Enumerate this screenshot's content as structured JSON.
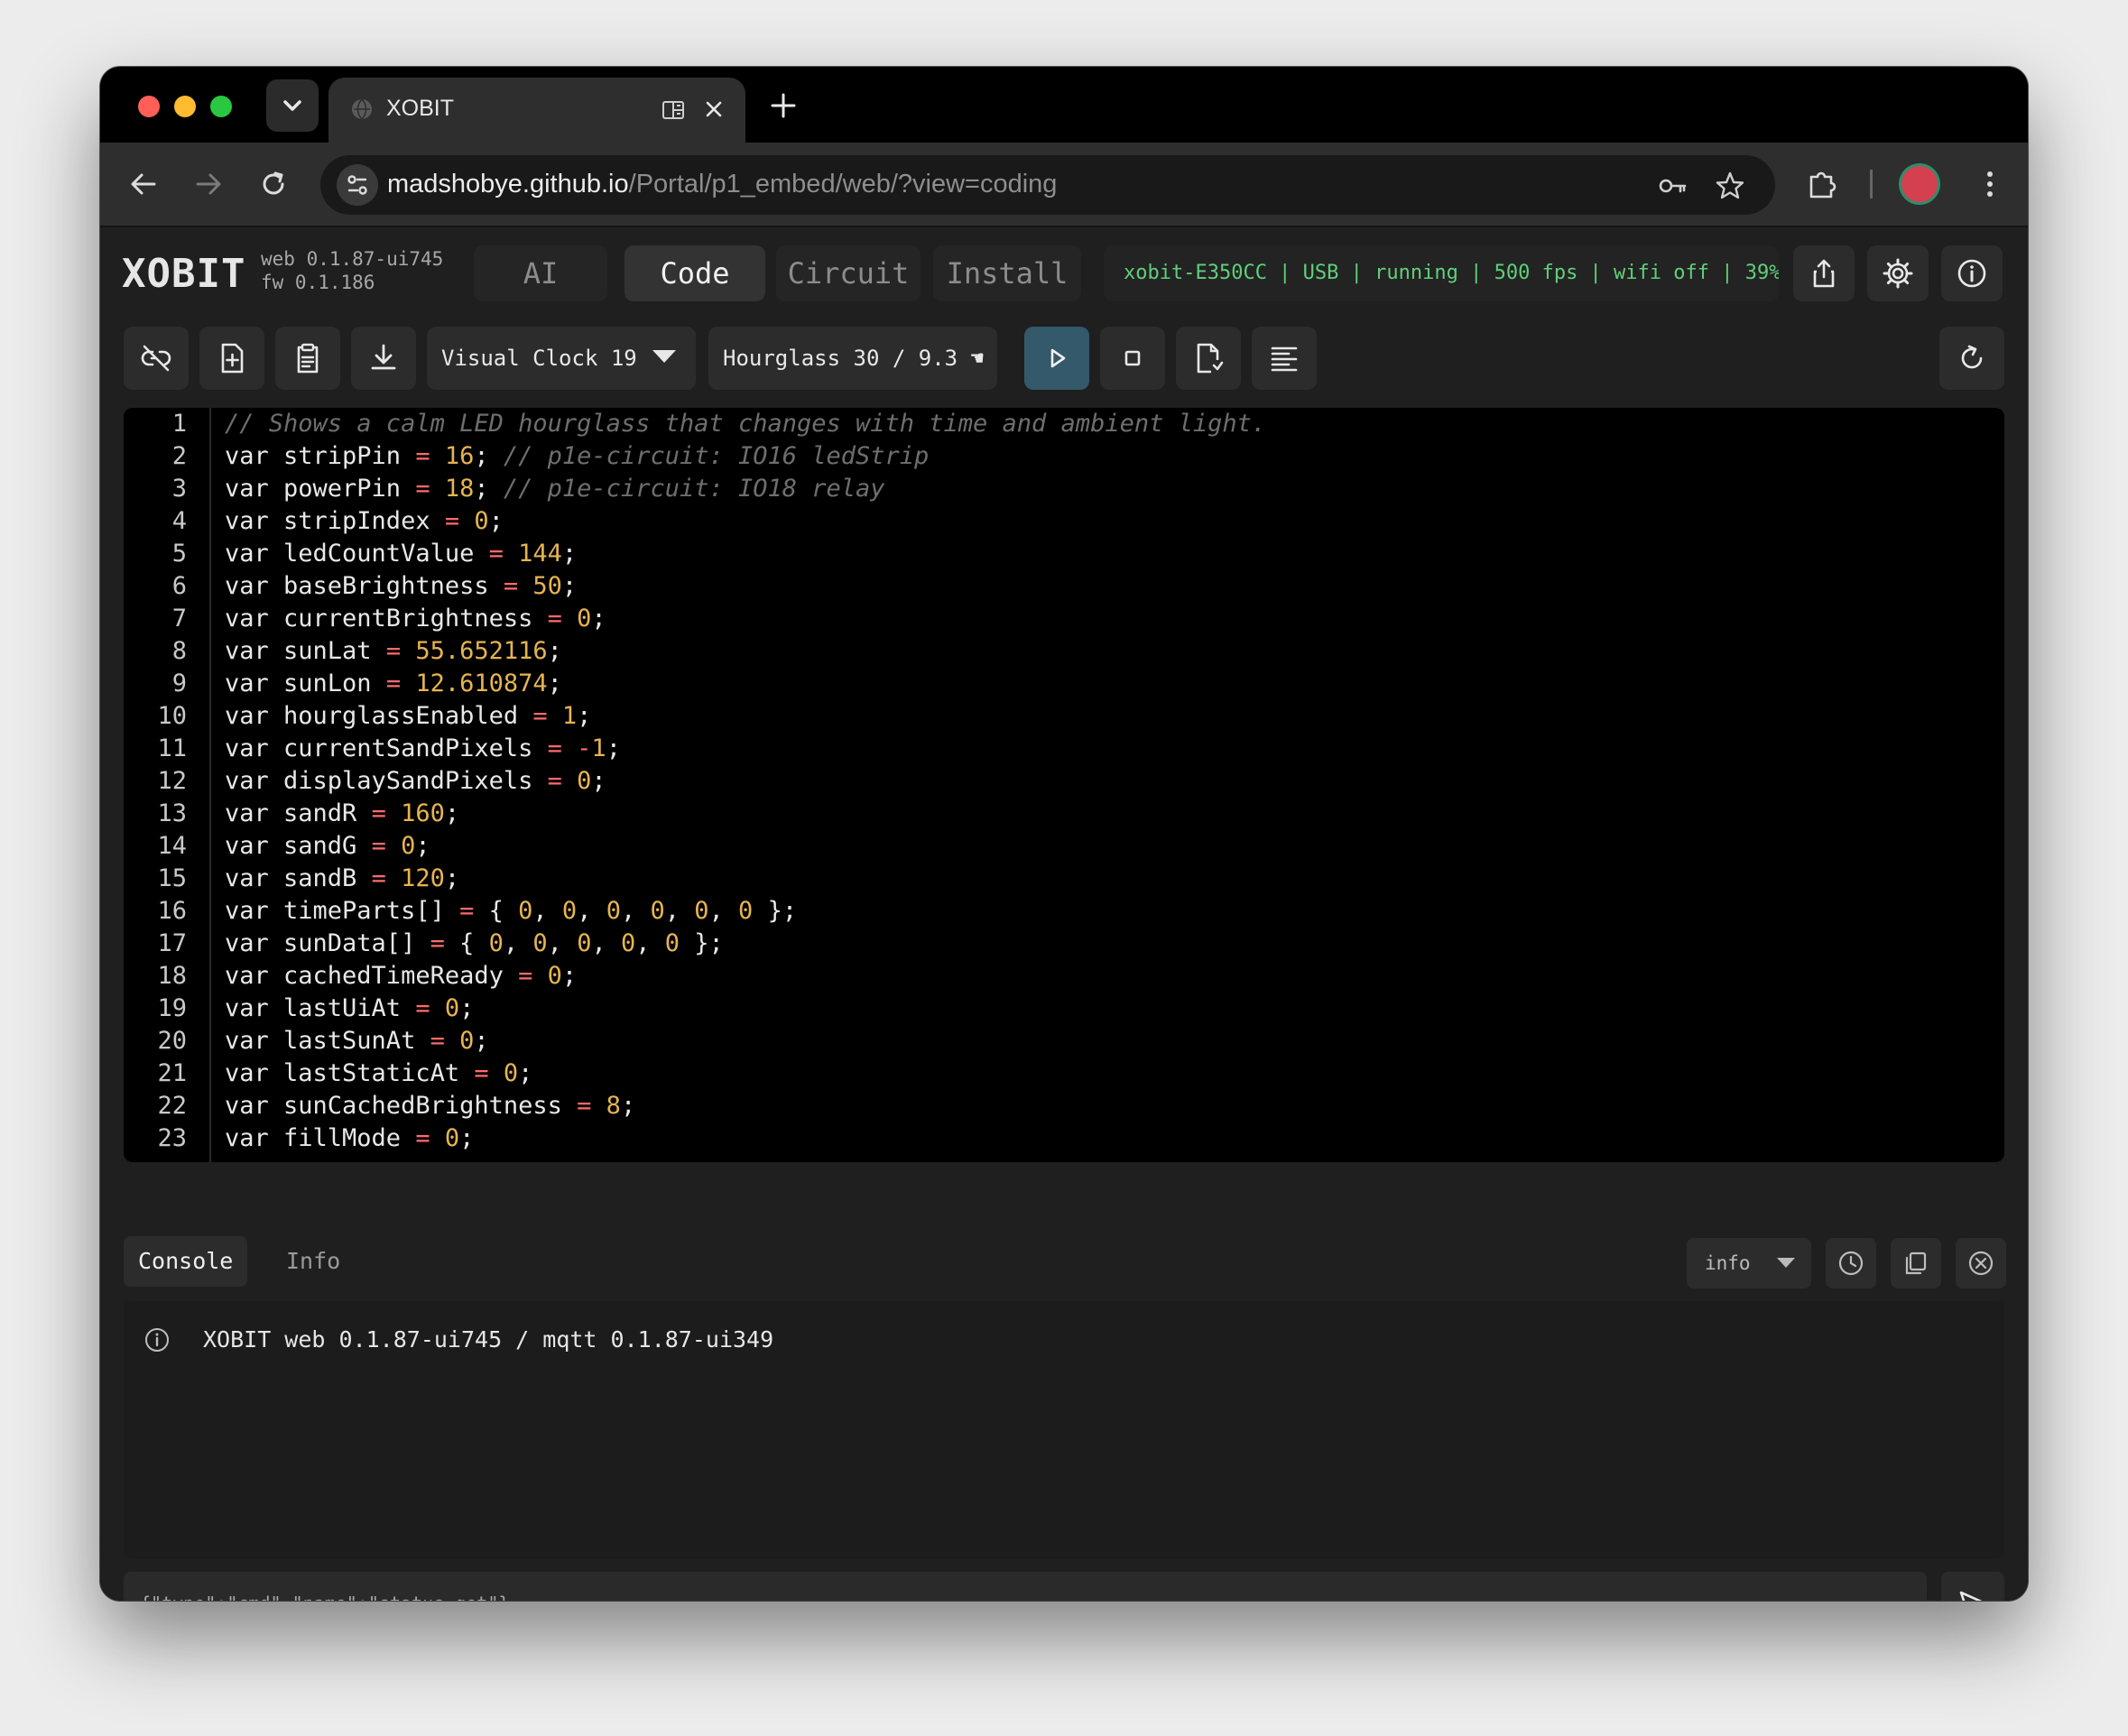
{
  "browser": {
    "tab_title": "XOBIT",
    "url_host": "madshobye.github.io",
    "url_path": "/Portal/p1_embed/web/?view=coding"
  },
  "app": {
    "logo": "XOBIT",
    "web_version": "web 0.1.87-ui745",
    "fw_version": "fw 0.1.186",
    "nav_tabs": [
      {
        "label": "AI",
        "active": false
      },
      {
        "label": "Code",
        "active": true
      },
      {
        "label": "Circuit",
        "active": false
      },
      {
        "label": "Install",
        "active": false
      }
    ],
    "status_text": "xobit-E350CC | USB | running | 500 fps | wifi off | 39%",
    "status_color": "#5fd07a"
  },
  "toolbar": {
    "program_select": "Visual Clock 19",
    "preset_select": "Hourglass 30 / 9.3 ☚"
  },
  "editor": {
    "lines": [
      "// Shows a calm LED hourglass that changes with time and ambient light.",
      "var stripPin = 16; // p1e-circuit: IO16 ledStrip",
      "var powerPin = 18; // p1e-circuit: IO18 relay",
      "var stripIndex = 0;",
      "var ledCountValue = 144;",
      "var baseBrightness = 50;",
      "var currentBrightness = 0;",
      "var sunLat = 55.652116;",
      "var sunLon = 12.610874;",
      "var hourglassEnabled = 1;",
      "var currentSandPixels = -1;",
      "var displaySandPixels = 0;",
      "var sandR = 160;",
      "var sandG = 0;",
      "var sandB = 120;",
      "var timeParts[] = { 0, 0, 0, 0, 0, 0 };",
      "var sunData[] = { 0, 0, 0, 0, 0 };",
      "var cachedTimeReady = 0;",
      "var lastUiAt = 0;",
      "var lastSunAt = 0;",
      "var lastStaticAt = 0;",
      "var sunCachedBrightness = 8;",
      "var fillMode = 0;"
    ],
    "colors": {
      "comment": "#6e6e6e",
      "number": "#e6b450",
      "operator": "#ff6b6b",
      "text": "#e8e8e8"
    }
  },
  "console": {
    "tabs": [
      {
        "label": "Console",
        "active": true
      },
      {
        "label": "Info",
        "active": false
      }
    ],
    "level": "info",
    "log": "XOBIT web 0.1.87-ui745 / mqtt 0.1.87-ui349",
    "input_placeholder": "{\"type\":\"cmd\",\"name\":\"status.get\"}"
  }
}
